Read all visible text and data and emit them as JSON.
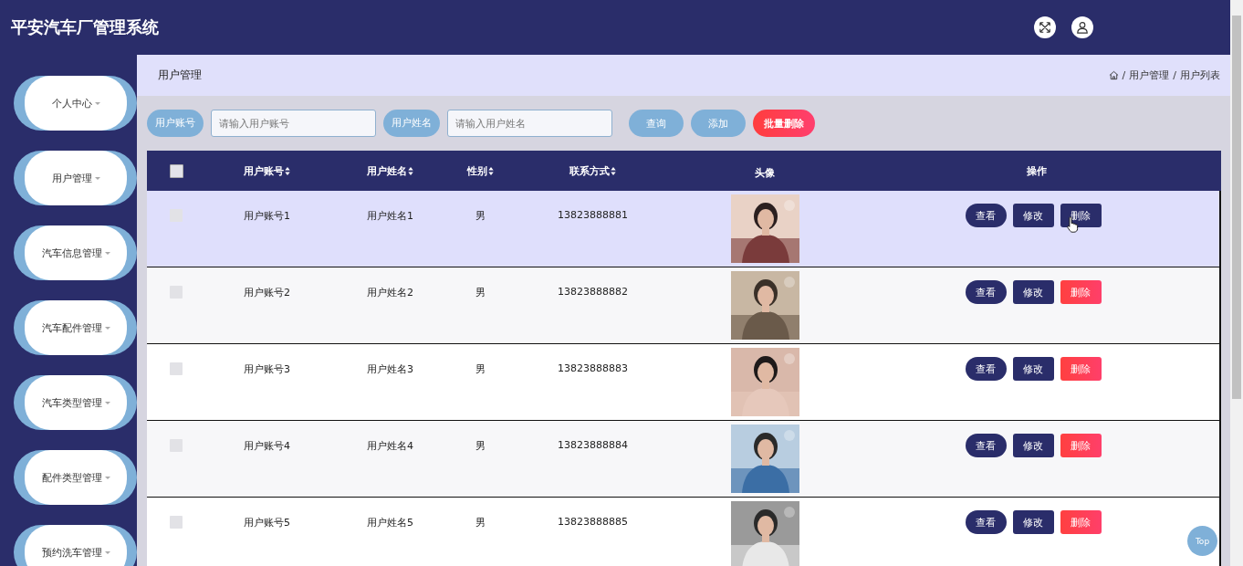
{
  "header": {
    "title": "平安汽车厂管理系统"
  },
  "sidebar": {
    "items": [
      {
        "label": "个人中心"
      },
      {
        "label": "用户管理"
      },
      {
        "label": "汽车信息管理"
      },
      {
        "label": "汽车配件管理"
      },
      {
        "label": "汽车类型管理"
      },
      {
        "label": "配件类型管理"
      },
      {
        "label": "预约洗车管理"
      }
    ]
  },
  "page": {
    "title": "用户管理",
    "breadcrumb": [
      "用户管理",
      "用户列表"
    ],
    "breadcrumb_separator": "/"
  },
  "search": {
    "fields": [
      {
        "label": "用户账号",
        "placeholder": "请输入用户账号"
      },
      {
        "label": "用户姓名",
        "placeholder": "请输入用户姓名"
      }
    ],
    "buttons": [
      {
        "label": "查询",
        "kind": "normal"
      },
      {
        "label": "添加",
        "kind": "normal"
      },
      {
        "label": "批量删除",
        "kind": "danger"
      }
    ]
  },
  "table": {
    "select_all": {
      "checked": false
    },
    "columns": [
      {
        "label": "用户账号",
        "sortable": true
      },
      {
        "label": "用户姓名",
        "sortable": true
      },
      {
        "label": "性别",
        "sortable": true
      },
      {
        "label": "联系方式",
        "sortable": true
      },
      {
        "label": "头像",
        "sortable": false
      },
      {
        "label": "操作",
        "sortable": false
      }
    ],
    "rows": [
      {
        "account": "用户账号1",
        "name": "用户姓名1",
        "gender": "男",
        "phone": "13823888881",
        "checked": false,
        "hovered": true,
        "actions": [
          "查看",
          "修改",
          "删除"
        ]
      },
      {
        "account": "用户账号2",
        "name": "用户姓名2",
        "gender": "男",
        "phone": "13823888882",
        "checked": false,
        "hovered": false,
        "actions": [
          "查看",
          "修改",
          "删除"
        ]
      },
      {
        "account": "用户账号3",
        "name": "用户姓名3",
        "gender": "男",
        "phone": "13823888883",
        "checked": false,
        "hovered": false,
        "actions": [
          "查看",
          "修改",
          "删除"
        ]
      },
      {
        "account": "用户账号4",
        "name": "用户姓名4",
        "gender": "男",
        "phone": "13823888884",
        "checked": false,
        "hovered": false,
        "actions": [
          "查看",
          "修改",
          "删除"
        ]
      },
      {
        "account": "用户账号5",
        "name": "用户姓名5",
        "gender": "男",
        "phone": "13823888885",
        "checked": false,
        "hovered": false,
        "actions": [
          "查看",
          "修改",
          "删除"
        ]
      }
    ]
  },
  "back_to_top": {
    "label": "Top"
  }
}
